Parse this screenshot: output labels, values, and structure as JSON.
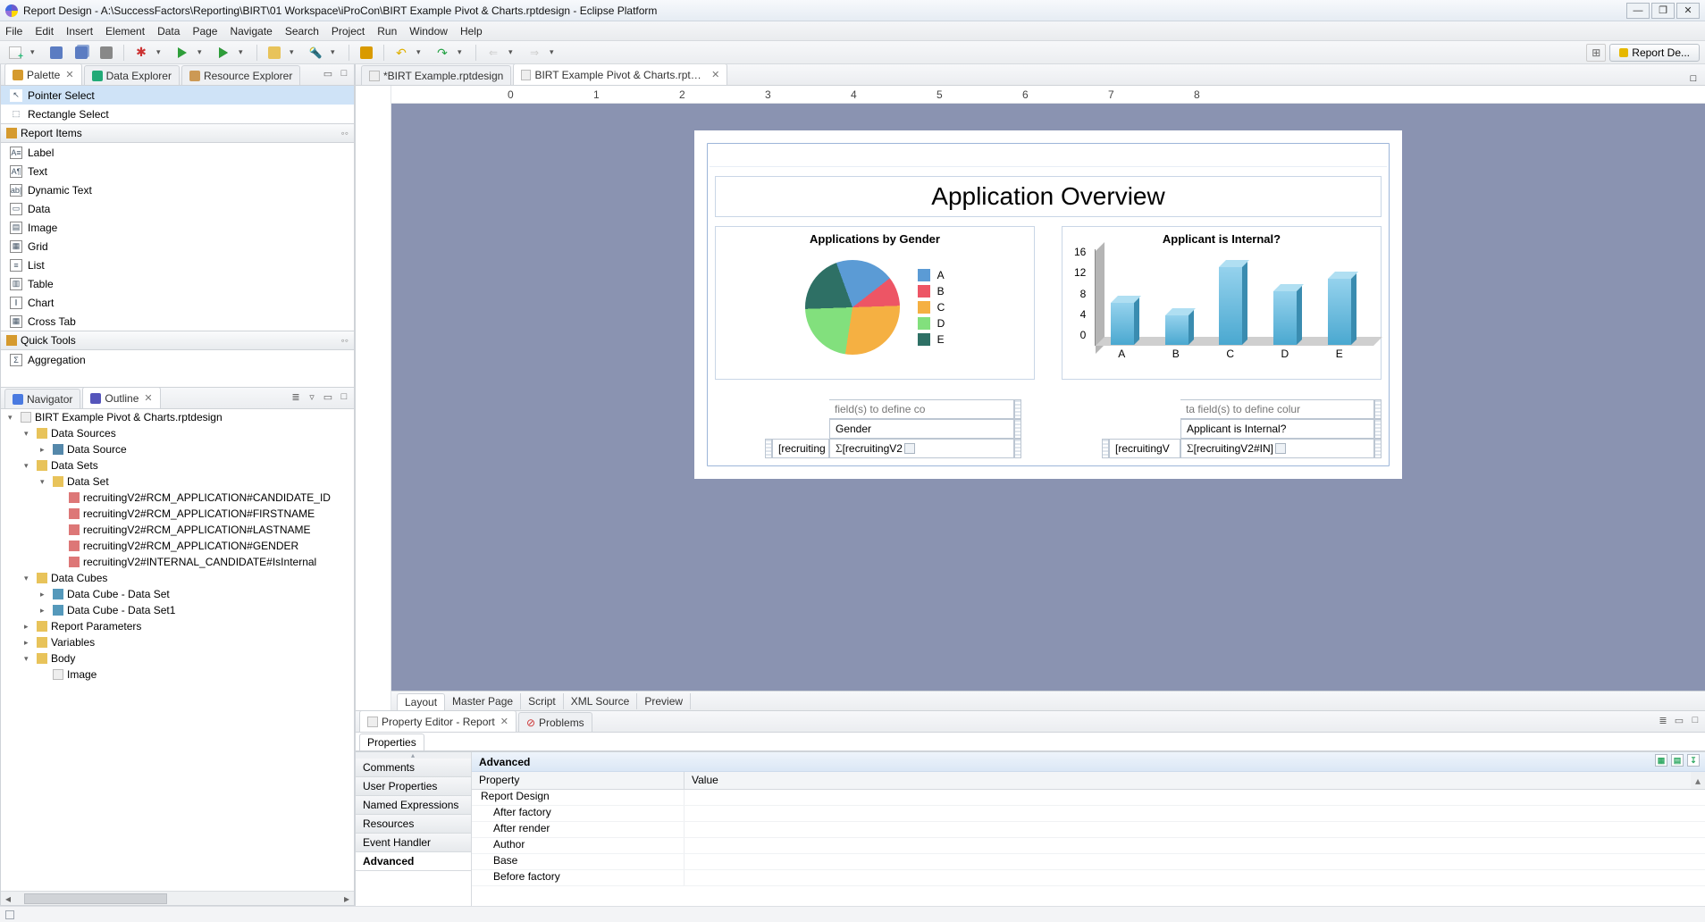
{
  "window": {
    "title": "Report Design - A:\\SuccessFactors\\Reporting\\BIRT\\01 Workspace\\iProCon\\BIRT Example Pivot & Charts.rptdesign - Eclipse Platform",
    "min": "—",
    "max": "❐",
    "close": "✕"
  },
  "menus": [
    "File",
    "Edit",
    "Insert",
    "Element",
    "Data",
    "Page",
    "Navigate",
    "Search",
    "Project",
    "Run",
    "Window",
    "Help"
  ],
  "perspective": "Report De...",
  "left": {
    "tabs_top": [
      "Palette",
      "Data Explorer",
      "Resource Explorer"
    ],
    "palette": {
      "pointer": "Pointer Select",
      "rect": "Rectangle Select",
      "section_items": "Report Items",
      "items": [
        "Label",
        "Text",
        "Dynamic Text",
        "Data",
        "Image",
        "Grid",
        "List",
        "Table",
        "Chart",
        "Cross Tab"
      ],
      "item_icons": [
        "A≡",
        "A¶",
        "ab|",
        "▭",
        "▤",
        "▦",
        "≡",
        "▥",
        "⫾",
        "▦"
      ],
      "section_quick": "Quick Tools",
      "aggregation": "Aggregation"
    },
    "tabs_bottom": [
      "Navigator",
      "Outline"
    ],
    "outline": {
      "root": "BIRT Example Pivot & Charts.rptdesign",
      "nodes": [
        {
          "l": "Data Sources",
          "lvl": 1,
          "exp": true,
          "i": "fold"
        },
        {
          "l": "Data Source",
          "lvl": 2,
          "i": "db"
        },
        {
          "l": "Data Sets",
          "lvl": 1,
          "exp": true,
          "i": "fold"
        },
        {
          "l": "Data Set",
          "lvl": 2,
          "exp": true,
          "i": "fold"
        },
        {
          "l": "recruitingV2#RCM_APPLICATION#CANDIDATE_ID",
          "lvl": 3,
          "i": "col"
        },
        {
          "l": "recruitingV2#RCM_APPLICATION#FIRSTNAME",
          "lvl": 3,
          "i": "col"
        },
        {
          "l": "recruitingV2#RCM_APPLICATION#LASTNAME",
          "lvl": 3,
          "i": "col"
        },
        {
          "l": "recruitingV2#RCM_APPLICATION#GENDER",
          "lvl": 3,
          "i": "col"
        },
        {
          "l": "recruitingV2#INTERNAL_CANDIDATE#IsInternal",
          "lvl": 3,
          "i": "col"
        },
        {
          "l": "Data Cubes",
          "lvl": 1,
          "exp": true,
          "i": "fold"
        },
        {
          "l": "Data Cube - Data Set",
          "lvl": 2,
          "i": "cube"
        },
        {
          "l": "Data Cube - Data Set1",
          "lvl": 2,
          "i": "cube"
        },
        {
          "l": "Report Parameters",
          "lvl": 1,
          "i": "fold"
        },
        {
          "l": "Variables",
          "lvl": 1,
          "i": "fold"
        },
        {
          "l": "Body",
          "lvl": 1,
          "exp": true,
          "i": "fold"
        },
        {
          "l": "Image",
          "lvl": 2,
          "i": "file"
        }
      ]
    }
  },
  "editor": {
    "tabs": [
      "*BIRT Example.rptdesign",
      "BIRT Example Pivot & Charts.rptdesign"
    ],
    "active_tab": 1,
    "ruler": [
      "0",
      "1",
      "2",
      "3",
      "4",
      "5",
      "6",
      "7",
      "8"
    ],
    "report": {
      "title": "Application Overview",
      "chart1": {
        "title": "Applications by Gender"
      },
      "chart2": {
        "title": "Applicant is Internal?"
      },
      "legend": [
        "A",
        "B",
        "C",
        "D",
        "E"
      ],
      "xtab1": {
        "hint": "field(s) to define co",
        "dim": "Gender",
        "m1": "[recruiting",
        "m2": "[recruitingV2"
      },
      "xtab2": {
        "hint": "ta field(s) to define colur",
        "dim": "Applicant is Internal?",
        "m1": "[recruitingV",
        "m2": "[recruitingV2#IN]"
      }
    },
    "bottom_tabs": [
      "Layout",
      "Master Page",
      "Script",
      "XML Source",
      "Preview"
    ]
  },
  "chart_data": [
    {
      "type": "pie",
      "title": "Applications by Gender",
      "categories": [
        "A",
        "B",
        "C",
        "D",
        "E"
      ],
      "values": [
        20,
        10,
        28,
        22,
        20
      ],
      "colors": [
        "#5b9bd5",
        "#ed5565",
        "#f5b042",
        "#82e07d",
        "#2e7065"
      ]
    },
    {
      "type": "bar",
      "title": "Applicant is Internal?",
      "categories": [
        "A",
        "B",
        "C",
        "D",
        "E"
      ],
      "values": [
        7,
        5,
        13,
        9,
        11
      ],
      "ylabel": "",
      "xlabel": "",
      "ylim": [
        0,
        16
      ],
      "yticks": [
        0,
        4,
        8,
        12,
        16
      ],
      "color": "#5cb3d9"
    }
  ],
  "property": {
    "tabs": [
      "Property Editor - Report",
      "Problems"
    ],
    "subtab": "Properties",
    "categories": [
      "Comments",
      "User Properties",
      "Named Expressions",
      "Resources",
      "Event Handler",
      "Advanced"
    ],
    "header": "Advanced",
    "cols": [
      "Property",
      "Value"
    ],
    "rows": [
      "Report Design",
      "After factory",
      "After render",
      "Author",
      "Base",
      "Before factory"
    ]
  },
  "status": ""
}
